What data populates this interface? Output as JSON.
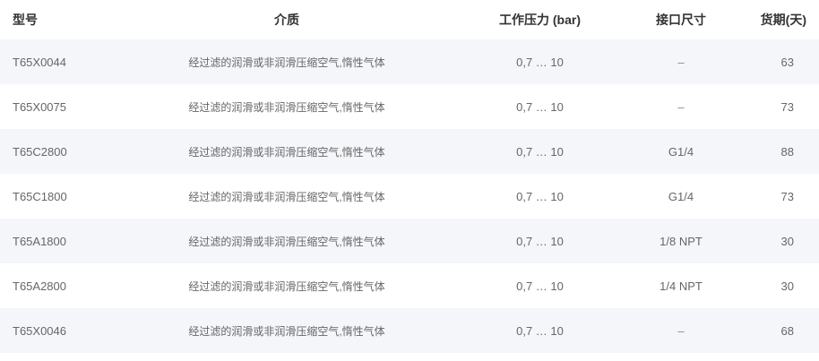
{
  "table": {
    "headers": {
      "model": "型号",
      "medium": "介质",
      "pressure": "工作压力 (bar)",
      "port": "接口尺寸",
      "lead_time": "货期(天)"
    },
    "rows": [
      {
        "model": "T65X0044",
        "medium": "经过滤的润滑或非润滑压缩空气,惰性气体",
        "pressure": "0,7 … 10",
        "port": "–",
        "lead_time": "63"
      },
      {
        "model": "T65X0075",
        "medium": "经过滤的润滑或非润滑压缩空气,惰性气体",
        "pressure": "0,7 … 10",
        "port": "–",
        "lead_time": "73"
      },
      {
        "model": "T65C2800",
        "medium": "经过滤的润滑或非润滑压缩空气,惰性气体",
        "pressure": "0,7 … 10",
        "port": "G1/4",
        "lead_time": "88"
      },
      {
        "model": "T65C1800",
        "medium": "经过滤的润滑或非润滑压缩空气,惰性气体",
        "pressure": "0,7 … 10",
        "port": "G1/4",
        "lead_time": "73"
      },
      {
        "model": "T65A1800",
        "medium": "经过滤的润滑或非润滑压缩空气,惰性气体",
        "pressure": "0,7 … 10",
        "port": "1/8 NPT",
        "lead_time": "30"
      },
      {
        "model": "T65A2800",
        "medium": "经过滤的润滑或非润滑压缩空气,惰性气体",
        "pressure": "0,7 … 10",
        "port": "1/4 NPT",
        "lead_time": "30"
      },
      {
        "model": "T65X0046",
        "medium": "经过滤的润滑或非润滑压缩空气,惰性气体",
        "pressure": "0,7 … 10",
        "port": "–",
        "lead_time": "68"
      }
    ]
  },
  "colors": {
    "row_alt_bg": "#f5f6fa",
    "row_bg": "#ffffff",
    "header_text": "#333333",
    "cell_text": "#666666"
  }
}
